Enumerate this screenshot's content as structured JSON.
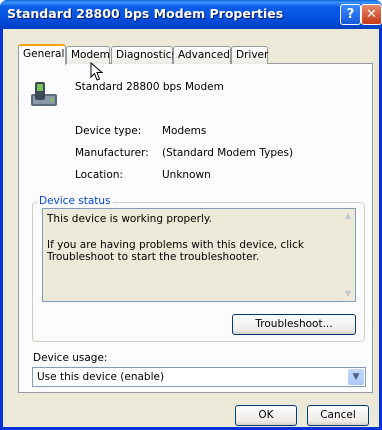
{
  "window": {
    "title": "Standard 28800 bps Modem Properties",
    "help_glyph": "?",
    "close_glyph": "✕"
  },
  "tabs": [
    {
      "label": "General",
      "active": true
    },
    {
      "label": "Modem",
      "active": false
    },
    {
      "label": "Diagnostics",
      "active": false
    },
    {
      "label": "Advanced",
      "active": false
    },
    {
      "label": "Driver",
      "active": false
    }
  ],
  "device": {
    "icon": "modem-device-icon",
    "name": "Standard 28800 bps Modem"
  },
  "properties": [
    {
      "label": "Device type:",
      "value": "Modems"
    },
    {
      "label": "Manufacturer:",
      "value": "(Standard Modem Types)"
    },
    {
      "label": "Location:",
      "value": "Unknown"
    }
  ],
  "status": {
    "legend": "Device status",
    "line1": "This device is working properly.",
    "line2": "If you are having problems with this device, click Troubleshoot to start the troubleshooter.",
    "troubleshoot_label": "Troubleshoot..."
  },
  "usage": {
    "label": "Device usage:",
    "value": "Use this device (enable)"
  },
  "footer": {
    "ok_label": "OK",
    "cancel_label": "Cancel"
  },
  "colors": {
    "title_bar": "#0055e5",
    "legend_text": "#0046d5",
    "active_tab_accent": "#f7a10f"
  }
}
